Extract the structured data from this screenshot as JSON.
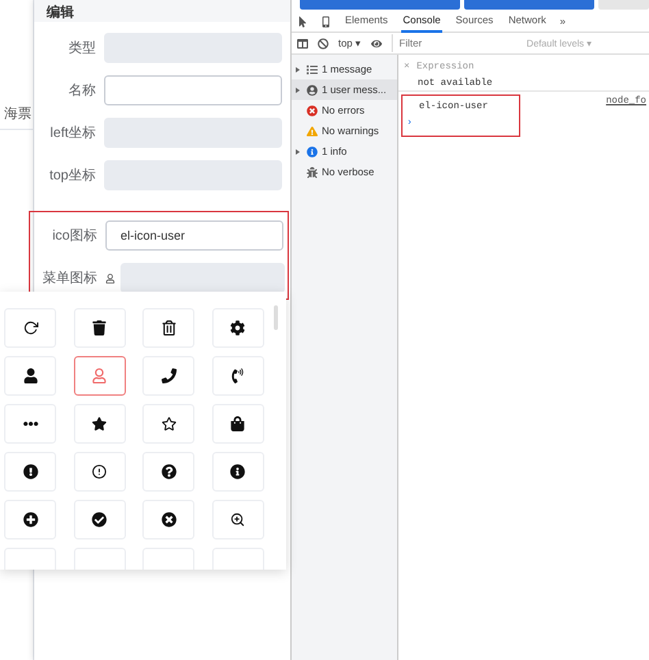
{
  "page_behind": {
    "text": "海票"
  },
  "editor": {
    "title": "编辑",
    "rows": [
      {
        "label": "类型",
        "value": "",
        "disabled": true
      },
      {
        "label": "名称",
        "value": "",
        "disabled": false
      },
      {
        "label": "left坐标",
        "value": "",
        "disabled": true
      },
      {
        "label": "top坐标",
        "value": "",
        "disabled": true
      }
    ],
    "highlighted_rows": [
      {
        "label": "ico图标",
        "value": "el-icon-user",
        "disabled": false,
        "kind": "text"
      },
      {
        "label": "菜单图标",
        "value": "",
        "disabled": true,
        "kind": "icon"
      }
    ]
  },
  "icon_picker": {
    "cells": [
      {
        "selected": false
      },
      {
        "selected": false
      },
      {
        "selected": false
      },
      {
        "selected": false
      },
      {
        "selected": false
      },
      {
        "selected": true
      },
      {
        "selected": false
      },
      {
        "selected": false
      },
      {
        "selected": false
      },
      {
        "selected": false
      },
      {
        "selected": false
      },
      {
        "selected": false
      },
      {
        "selected": false
      },
      {
        "selected": false
      },
      {
        "selected": false
      },
      {
        "selected": false
      },
      {
        "selected": false
      },
      {
        "selected": false
      },
      {
        "selected": false
      },
      {
        "selected": false
      },
      {
        "selected": false
      },
      {
        "selected": false
      },
      {
        "selected": false
      },
      {
        "selected": false
      }
    ]
  },
  "devtools": {
    "tabs": [
      {
        "label": "Elements",
        "selected": false
      },
      {
        "label": "Console",
        "selected": true
      },
      {
        "label": "Sources",
        "selected": false
      },
      {
        "label": "Network",
        "selected": false
      }
    ],
    "more": "»",
    "context": "top ▾",
    "filter": {
      "placeholder": "Filter"
    },
    "levels": "Default levels ▾",
    "sidebar": [
      {
        "kind": "messages",
        "label": "1 message",
        "expandable": true,
        "selected": false
      },
      {
        "kind": "user",
        "label": "1 user mess...",
        "expandable": true,
        "selected": true
      },
      {
        "kind": "errors",
        "label": "No errors",
        "expandable": false,
        "selected": false
      },
      {
        "kind": "warnings",
        "label": "No warnings",
        "expandable": false,
        "selected": false
      },
      {
        "kind": "info",
        "label": "1 info",
        "expandable": true,
        "selected": false
      },
      {
        "kind": "verbose",
        "label": "No verbose",
        "expandable": false,
        "selected": false
      }
    ],
    "expression": {
      "close": "×",
      "label": "Expression",
      "value": "not available"
    },
    "log": {
      "message": "el-icon-user",
      "source": "node_fo",
      "prompt": "›"
    }
  }
}
